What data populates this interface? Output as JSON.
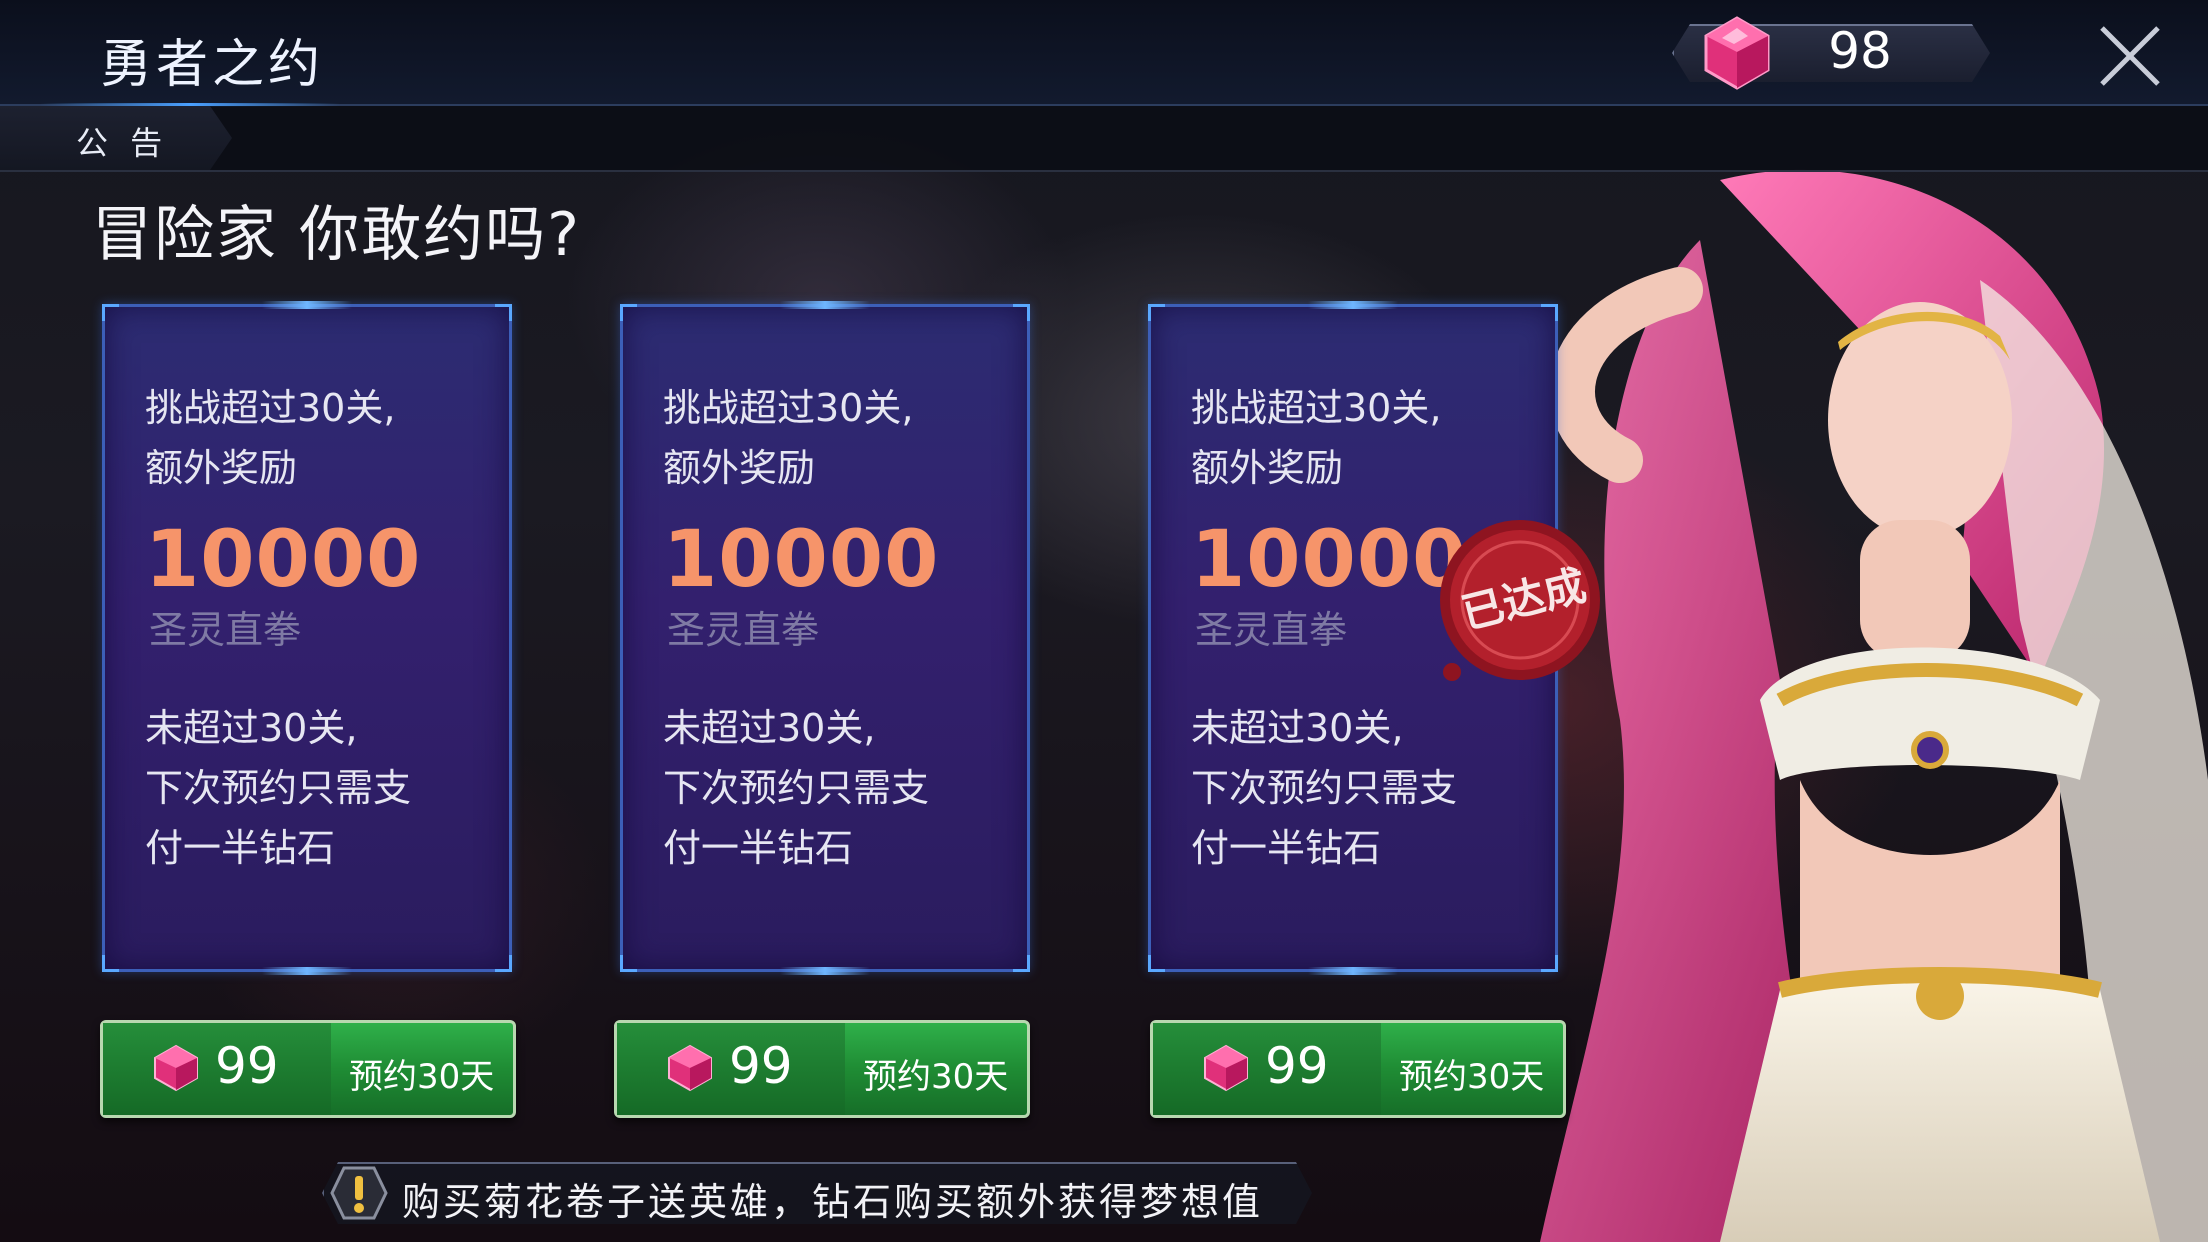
{
  "header": {
    "title": "勇者之约",
    "gems": "98"
  },
  "tabs": [
    {
      "label": "公 告"
    }
  ],
  "headline": "冒险家  你敢约吗?",
  "cards": [
    {
      "line1": "挑战超过30关,",
      "line2": "额外奖励",
      "amount": "10000",
      "unit": "圣灵直拳",
      "line3": "未超过30关,",
      "line4": "下次预约只需支",
      "line5": "付一半钻石"
    },
    {
      "line1": "挑战超过30关,",
      "line2": "额外奖励",
      "amount": "10000",
      "unit": "圣灵直拳",
      "line3": "未超过30关,",
      "line4": "下次预约只需支",
      "line5": "付一半钻石"
    },
    {
      "line1": "挑战超过30关,",
      "line2": "额外奖励",
      "amount": "10000",
      "unit": "圣灵直拳",
      "line3": "未超过30关,",
      "line4": "下次预约只需支",
      "line5": "付一半钻石",
      "stamp": "已达成"
    }
  ],
  "buttons": [
    {
      "price": "99",
      "action": "预约30天"
    },
    {
      "price": "99",
      "action": "预约30天"
    },
    {
      "price": "99",
      "action": "预约30天"
    }
  ],
  "notice": "购买菊花卷子送英雄，钻石购买额外获得梦想值",
  "colors": {
    "accent_orange": "#f6946a",
    "button_green": "#1f8c34",
    "card_border": "#3c5fb8",
    "gem": "#e0307a",
    "seal_red": "#b3202c"
  },
  "icons": [
    "gem-icon",
    "close-icon",
    "warning-icon",
    "seal-stamp"
  ]
}
